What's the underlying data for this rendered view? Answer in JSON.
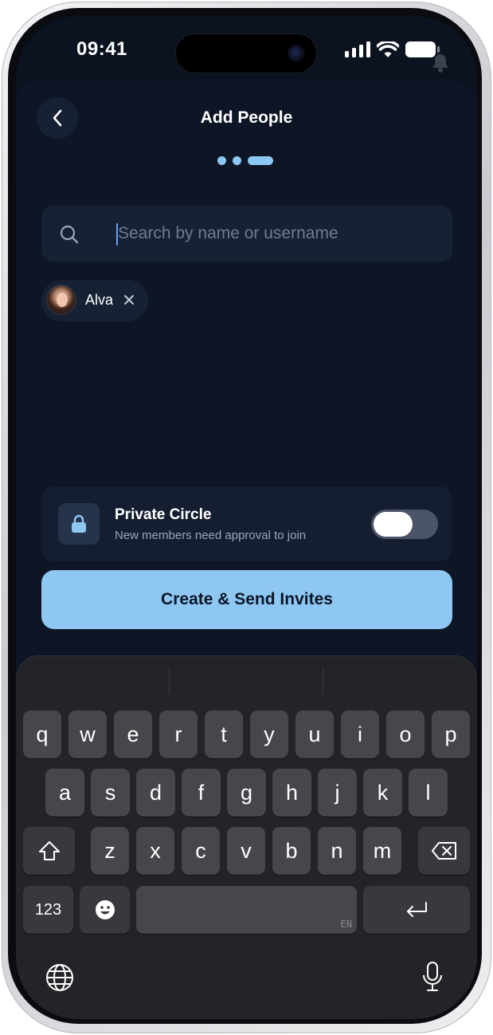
{
  "status": {
    "time": "09:41"
  },
  "header": {
    "title": "Add People",
    "steps_total": 3,
    "active_step": 3
  },
  "search": {
    "placeholder": "Search by name or username",
    "value": ""
  },
  "selected_people": [
    {
      "name": "Alva"
    }
  ],
  "private_circle": {
    "title": "Private Circle",
    "subtitle": "New members need approval to join",
    "enabled": false
  },
  "cta": {
    "label": "Create & Send Invites"
  },
  "keyboard": {
    "row1": [
      "q",
      "w",
      "e",
      "r",
      "t",
      "y",
      "u",
      "i",
      "o",
      "p"
    ],
    "row2": [
      "a",
      "s",
      "d",
      "f",
      "g",
      "h",
      "j",
      "k",
      "l"
    ],
    "row3": [
      "z",
      "x",
      "c",
      "v",
      "b",
      "n",
      "m"
    ],
    "numbers_label": "123",
    "language_tag": "EN"
  },
  "colors": {
    "accent": "#8ec8f2",
    "background": "#0e1626",
    "card": "#172134"
  },
  "icons": [
    "back-chevron-icon",
    "search-icon",
    "close-icon",
    "lock-icon",
    "shift-icon",
    "backspace-icon",
    "emoji-icon",
    "return-icon",
    "globe-icon",
    "microphone-icon",
    "bell-icon",
    "signal-icon",
    "wifi-icon",
    "battery-icon"
  ]
}
